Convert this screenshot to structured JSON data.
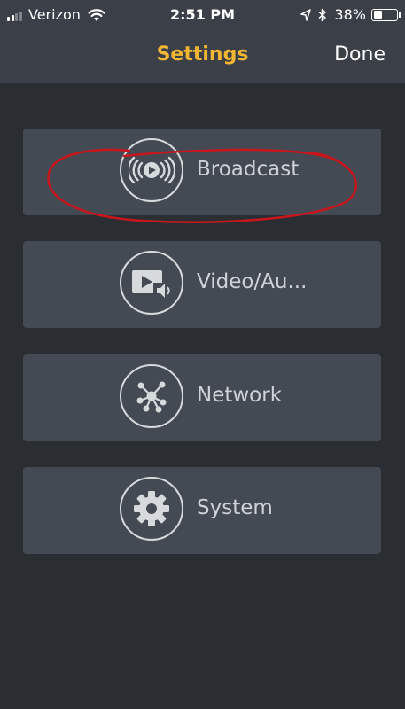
{
  "status_bar": {
    "carrier": "Verizon",
    "time": "2:51 PM",
    "battery_percent": "38%",
    "battery_level": 0.38,
    "signal_bars": 2
  },
  "nav": {
    "title": "Settings",
    "done_label": "Done"
  },
  "menu": {
    "items": [
      {
        "label": "Broadcast",
        "icon": "broadcast-icon"
      },
      {
        "label": "Video/Au...",
        "icon": "video-audio-icon"
      },
      {
        "label": "Network",
        "icon": "network-icon"
      },
      {
        "label": "System",
        "icon": "gear-icon"
      }
    ]
  },
  "colors": {
    "accent_title": "#f2b632",
    "annotation": "#c8161d",
    "background": "#2a2e33",
    "tile": "#434a53"
  }
}
